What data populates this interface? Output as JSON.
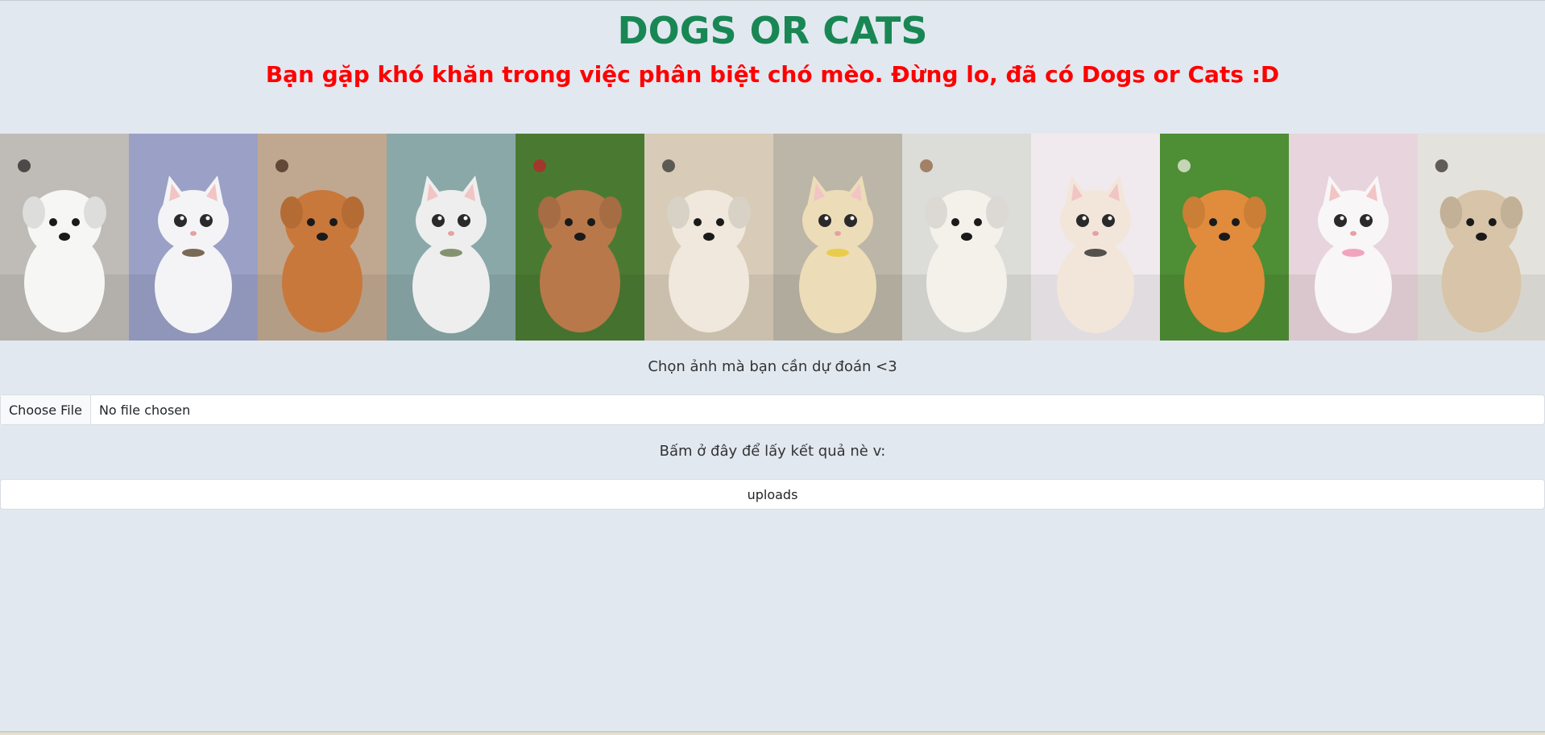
{
  "header": {
    "title": "DOGS OR CATS",
    "subtitle": "Bạn gặp khó khăn trong việc phân biệt chó mèo. Đừng lo, đã có Dogs or Cats :D"
  },
  "gallery": {
    "images": [
      {
        "animal": "dog",
        "bg": "#bfbcb7",
        "fur": "#f6f6f4",
        "accent": "#1a1a1a"
      },
      {
        "animal": "cat",
        "bg": "#9aa0c6",
        "fur": "#f4f4f6",
        "accent": "#5a4630"
      },
      {
        "animal": "dog",
        "bg": "#c0a890",
        "fur": "#c8783a",
        "accent": "#3a2010"
      },
      {
        "animal": "cat",
        "bg": "#8aa8a8",
        "fur": "#eeeeee",
        "accent": "#6a7a50"
      },
      {
        "animal": "dog",
        "bg": "#4a7a32",
        "fur": "#b8784a",
        "accent": "#c41e2a"
      },
      {
        "animal": "dog",
        "bg": "#d8ccb8",
        "fur": "#f0e8dc",
        "accent": "#2a2a2a"
      },
      {
        "animal": "cat",
        "bg": "#bcb6a8",
        "fur": "#ecdcb8",
        "accent": "#e8c830"
      },
      {
        "animal": "dog",
        "bg": "#dcdcd8",
        "fur": "#f4f0ea",
        "accent": "#8a5a38"
      },
      {
        "animal": "cat",
        "bg": "#f0eaee",
        "fur": "#f2e6da",
        "accent": "#2a2a2a"
      },
      {
        "animal": "dog",
        "bg": "#4e8e34",
        "fur": "#e08c3c",
        "accent": "#f8f4ee"
      },
      {
        "animal": "cat",
        "bg": "#e8d4dc",
        "fur": "#f8f6f6",
        "accent": "#f090b0"
      },
      {
        "animal": "dog",
        "bg": "#e4e2dc",
        "fur": "#d8c4a8",
        "accent": "#2a2420"
      }
    ]
  },
  "form": {
    "choose_caption": "Chọn ảnh mà bạn cần dự đoán <3",
    "file_button_label": "Choose File",
    "file_status": "No file chosen",
    "submit_caption": "Bấm ở đây để lấy kết quả nè v:",
    "upload_label": "uploads"
  },
  "colors": {
    "background": "#e2e8f0",
    "title": "#198754",
    "subtitle": "#ff0000"
  }
}
